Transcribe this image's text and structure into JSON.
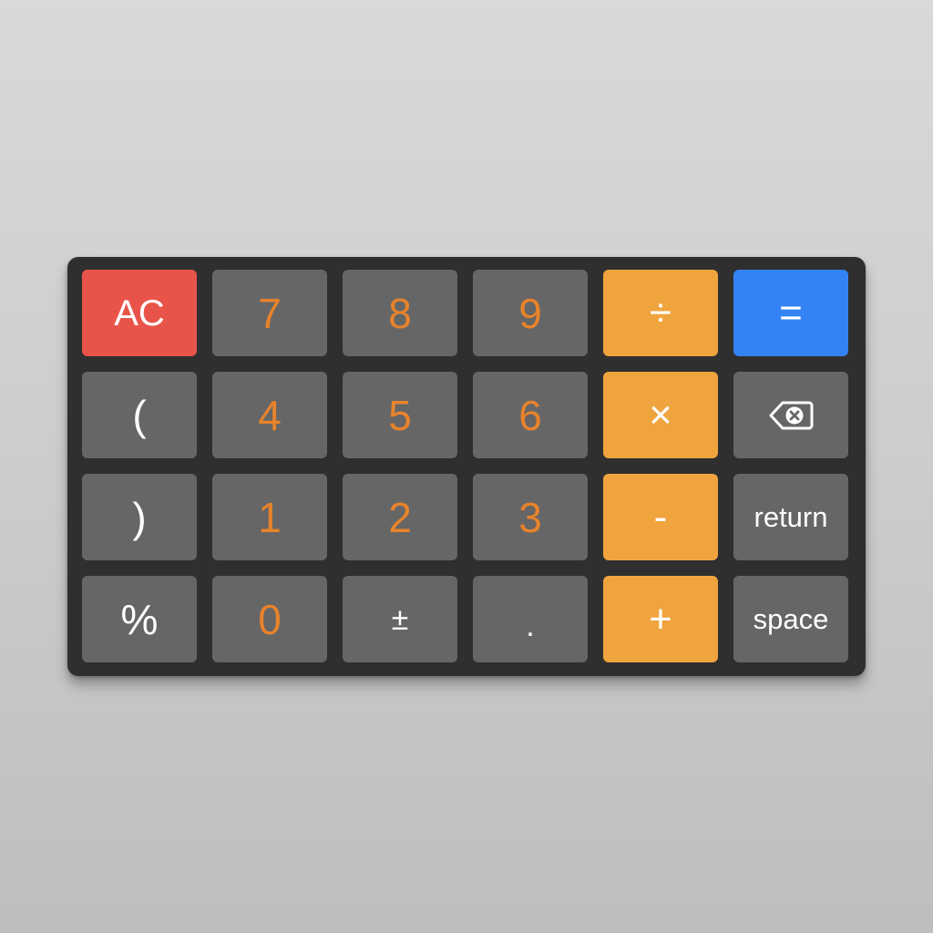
{
  "keypad": {
    "keys": {
      "ac": "AC",
      "k7": "7",
      "k8": "8",
      "k9": "9",
      "divide": "÷",
      "equals": "=",
      "lparen": "(",
      "k4": "4",
      "k5": "5",
      "k6": "6",
      "multiply": "×",
      "backspace_icon": "delete-left-icon",
      "rparen": ")",
      "k1": "1",
      "k2": "2",
      "k3": "3",
      "minus": "-",
      "return": "return",
      "percent": "%",
      "k0": "0",
      "plusminus": "±",
      "decimal": ".",
      "plus": "+",
      "space": "space"
    },
    "colors": {
      "background": "#2f2f2f",
      "key_gray": "#666666",
      "key_orange": "#f0a43e",
      "key_red": "#e9544a",
      "key_blue": "#3483f5",
      "digit_text": "#e8832b"
    }
  }
}
